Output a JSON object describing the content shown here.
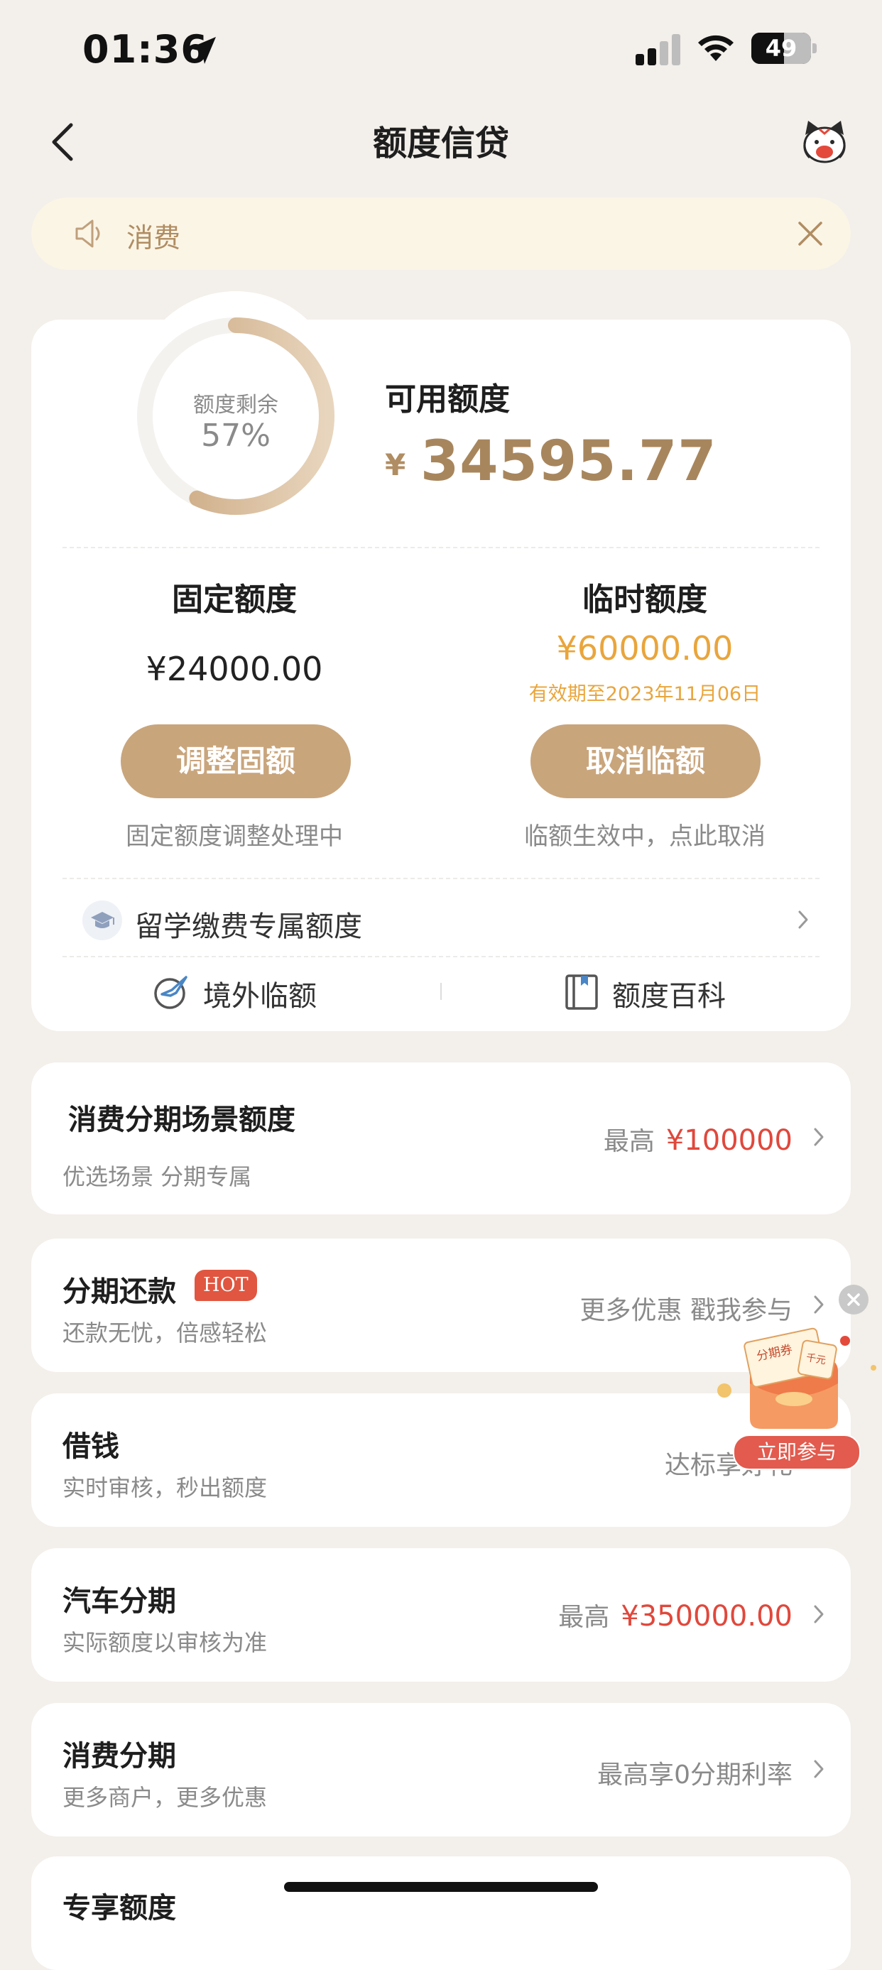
{
  "status_bar": {
    "time": "01:36",
    "battery": "49"
  },
  "nav": {
    "title": "额度信贷"
  },
  "notice": {
    "text": "消费"
  },
  "credit": {
    "ring_label": "额度剩余",
    "ring_percent": "57%",
    "remaining_fraction": 0.57,
    "available_label": "可用额度",
    "currency": "¥",
    "available_amount": "34595.77",
    "fixed_label": "固定额度",
    "fixed_amount": "¥24000.00",
    "fixed_button": "调整固额",
    "fixed_note": "固定额度调整处理中",
    "temp_label": "临时额度",
    "temp_amount": "¥60000.00",
    "temp_expiry": "有效期至2023年11月06日",
    "temp_button": "取消临额",
    "temp_note": "临额生效中，点此取消",
    "study_label": "留学缴费专属额度",
    "overseas_label": "境外临额",
    "wiki_label": "额度百科"
  },
  "scene": {
    "title": "消费分期场景额度",
    "subtitle": "优选场景 分期专属",
    "right_prefix": "最高",
    "right_amount": "¥100000"
  },
  "list": [
    {
      "title": "分期还款",
      "badge": "HOT",
      "subtitle": "还款无忧，倍感轻松",
      "right": "更多优惠 戳我参与"
    },
    {
      "title": "借钱",
      "subtitle": "实时审核，秒出额度",
      "right": "达标享好礼"
    },
    {
      "title": "汽车分期",
      "subtitle": "实际额度以审核为准",
      "right_prefix": "最高",
      "right_amount": "¥350000.00"
    },
    {
      "title": "消费分期",
      "subtitle": "更多商户，更多优惠",
      "right": "最高享0分期利率"
    },
    {
      "title": "专享额度"
    }
  ],
  "promo": {
    "coupon_text": "分期券",
    "coupon_tag": "千元",
    "button": "立即参与"
  },
  "colors": {
    "accent": "#c9a57c",
    "gold_text": "#a8865d",
    "orange": "#e9a53c",
    "red": "#e0483c",
    "background": "#f3efea"
  }
}
